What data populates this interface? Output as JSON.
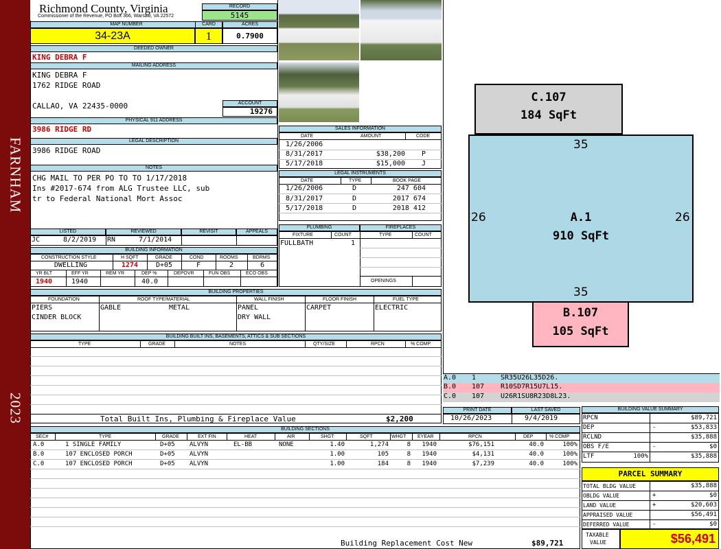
{
  "sidebar": {
    "district": "FARNHAM",
    "year": "2023"
  },
  "header": {
    "county": "Richmond County, Virginia",
    "commissioner": "Commissioner of the Revenue, PO Box 366, Warsaw, VA 22572",
    "record_label": "RECORD",
    "record": "5145",
    "map_label": "MAP NUMBER",
    "map_number": "34-23A",
    "card_label": "CARD",
    "card": "1",
    "acres_label": "ACRES",
    "acres": "0.7900"
  },
  "owner": {
    "deeded_label": "DEEDED OWNER",
    "deeded": "KING DEBRA F",
    "mailing_label": "MAILING ADDRESS",
    "mailing": [
      "KING DEBRA F",
      "1762 RIDGE ROAD",
      "",
      "CALLAO, VA 22435-0000"
    ],
    "account_label": "ACCOUNT",
    "account": "19276",
    "physical_label": "PHYSICAL 911 ADDRESS",
    "physical": "3986 RIDGE RD"
  },
  "legal": {
    "label": "LEGAL DESCRIPTION",
    "text": "3986 RIDGE ROAD"
  },
  "notes": {
    "label": "NOTES",
    "lines": [
      "CHG MAIL TO PER PO TO TO 1/17/2018",
      "Ins #2017-674 from ALG Trustee LLC, sub",
      "tr to Federal National Mort Assoc"
    ]
  },
  "sales": {
    "label": "SALES INFORMATION",
    "cols": [
      "DATE",
      "AMOUNT",
      "CODE"
    ],
    "rows": [
      {
        "date": "1/26/2006",
        "amount": "",
        "code": ""
      },
      {
        "date": "8/31/2017",
        "amount": "$38,200",
        "code": "P"
      },
      {
        "date": "5/17/2018",
        "amount": "$15,000",
        "code": "J"
      }
    ]
  },
  "instruments": {
    "label": "LEGAL INSTRUMENTS",
    "cols": [
      "DATE",
      "TYPE",
      "BOOK PAGE"
    ],
    "rows": [
      {
        "date": "1/26/2006",
        "type": "D",
        "book": "247 604"
      },
      {
        "date": "8/31/2017",
        "type": "D",
        "book": "2017 674"
      },
      {
        "date": "5/17/2018",
        "type": "D",
        "book": "2018 412"
      }
    ]
  },
  "review": {
    "cols": [
      "LISTED",
      "REVIEWED",
      "REVISIT",
      "APPEALS"
    ],
    "listed_by": "JC",
    "listed": "8/2/2019",
    "reviewed_by": "RN",
    "reviewed": "7/1/2014"
  },
  "building_info": {
    "label": "BUILDING INFORMATION",
    "cols1": [
      "CONSTRUCTION STYLE",
      "H SQFT",
      "GRADE",
      "COND",
      "ROOMS",
      "BDRMS"
    ],
    "vals1": [
      "DWELLING",
      "1274",
      "D+05",
      "F",
      "2",
      "6"
    ],
    "cols2": [
      "YR BLT",
      "EFF YR",
      "REM YR",
      "DEP %",
      "DEPOVR",
      "FUN OBS",
      "ECO OBS"
    ],
    "vals2": [
      "1940",
      "1940",
      "",
      "40.0",
      "",
      "",
      ""
    ]
  },
  "plumbing": {
    "label": "PLUMBING",
    "cols": [
      "FIXTURE",
      "COUNT"
    ],
    "fixture": "FULLBATH",
    "count": "1"
  },
  "fireplaces": {
    "label": "FIREPLACES",
    "cols": [
      "TYPE",
      "COUNT"
    ],
    "openings": "OPENINGS"
  },
  "properties": {
    "label": "BUILDING PROPERTIES",
    "cols": [
      "FOUNDATION",
      "ROOF TYPE/MATERIAL",
      "WALL FINISH",
      "FLOOR FINISH",
      "FUEL TYPE"
    ],
    "foundation": [
      "PIERS",
      "CINDER BLOCK"
    ],
    "roof_type": "GABLE",
    "roof_material": "METAL",
    "wall": [
      "PANEL",
      "DRY WALL"
    ],
    "floor": "CARPET",
    "fuel": "ELECTRIC"
  },
  "builtins": {
    "label": "BUILDING BUILT INS, BASEMENTS, ATTICS & SUB SECTIONS",
    "cols": [
      "TYPE",
      "GRADE",
      "NOTES",
      "QTY/SIZE",
      "RPCN",
      "% COMP"
    ],
    "total_label": "Total Built Ins, Plumbing & Fireplace Value",
    "total": "$2,200"
  },
  "dates": {
    "print_label": "PRINT DATE",
    "print": "10/26/2023",
    "saved_label": "LAST SAVED",
    "saved": "9/4/2019"
  },
  "sections": {
    "label": "BUILDING SECTIONS",
    "cols": [
      "SEC#",
      "TYPE",
      "GRADE",
      "EXT FIN",
      "HEAT",
      "AIR",
      "SHGT",
      "SQFT",
      "WHGT",
      "EYEAR",
      "RPCN",
      "DEP",
      "% COMP"
    ],
    "rows": [
      [
        "A.0",
        "1 SINGLE FAMILY",
        "D+05",
        "ALVYN",
        "EL-BB",
        "NONE",
        "1.40",
        "1,274",
        "8",
        "1940",
        "$76,151",
        "40.0",
        "100%"
      ],
      [
        "B.0",
        "107 ENCLOSED PORCH",
        "D+05",
        "ALVYN",
        "",
        "",
        "1.00",
        "105",
        "8",
        "1940",
        "$4,131",
        "40.0",
        "100%"
      ],
      [
        "C.0",
        "107 ENCLOSED PORCH",
        "D+05",
        "ALVYN",
        "",
        "",
        "1.00",
        "184",
        "8",
        "1940",
        "$7,239",
        "40.0",
        "100%"
      ]
    ],
    "replacement_label": "Building Replacement Cost New",
    "replacement": "$89,721"
  },
  "sketch": {
    "main": {
      "name": "A.1",
      "area": "910 SqFt",
      "top": "35",
      "bottom": "35",
      "left": "26",
      "right": "26"
    },
    "porch_c": {
      "name": "C.107",
      "area": "184 SqFt"
    },
    "porch_b": {
      "name": "B.107",
      "area": "105 SqFt"
    },
    "legend": [
      {
        "code": "A.0",
        "num": "1",
        "vector": "SR35U26L35D26."
      },
      {
        "code": "B.0",
        "num": "107",
        "vector": "R10SD7R15U7L15."
      },
      {
        "code": "C.0",
        "num": "107",
        "vector": "U26R1SU8R23D8L23."
      }
    ],
    "colors": {
      "main": "#add8e6",
      "porch_c": "#d3d3d3",
      "porch_b": "#ffb6c1"
    }
  },
  "value_summary": {
    "label": "BUILDING VALUE SUMMARY",
    "rows": [
      {
        "k": "RPCN",
        "sign": "",
        "v": "$89,721"
      },
      {
        "k": "DEP",
        "sign": "-",
        "v": "$53,833"
      },
      {
        "k": "RCLND",
        "sign": "",
        "v": "$35,888"
      },
      {
        "k": "OBS F/E",
        "sign": "-",
        "v": "$0"
      },
      {
        "k": "LTF",
        "pct": "100%",
        "sign": "",
        "v": "$35,888"
      }
    ]
  },
  "parcel": {
    "label": "PARCEL SUMMARY",
    "rows": [
      {
        "k": "TOTAL BLDG VALUE",
        "sign": "",
        "v": "$35,888"
      },
      {
        "k": "OBLDG VALUE",
        "sign": "+",
        "v": "$0"
      },
      {
        "k": "LAND VALUE",
        "sign": "+",
        "v": "$20,603"
      },
      {
        "k": "APPRAISED VALUE",
        "sign": "",
        "v": "$56,491"
      },
      {
        "k": "DEFERRED VALUE",
        "sign": "-",
        "v": "$0"
      }
    ],
    "taxable_label_1": "TAXABLE",
    "taxable_label_2": "VALUE",
    "taxable": "$56,491"
  }
}
